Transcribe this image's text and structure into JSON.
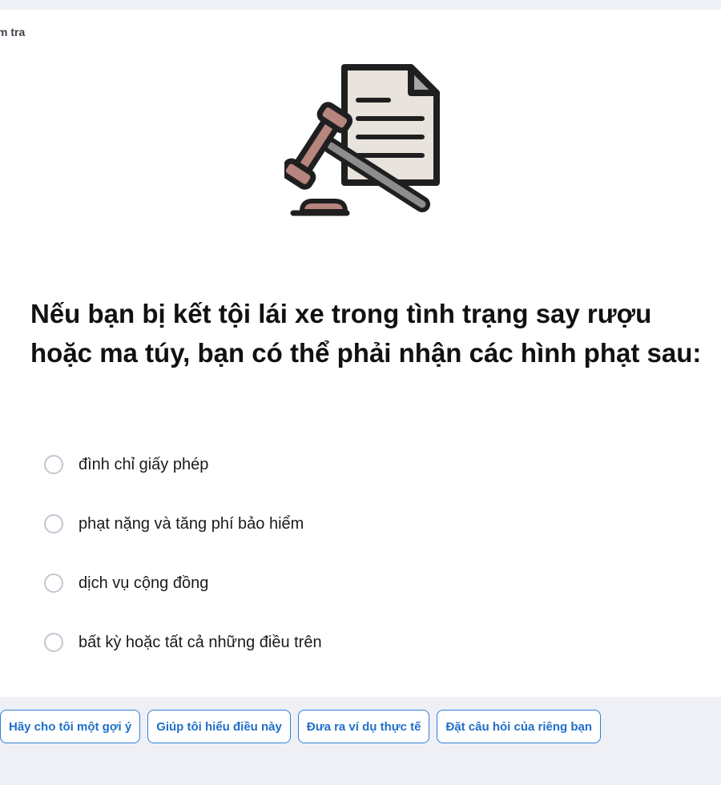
{
  "breadcrumb": "m tra",
  "illustration": {
    "icon": "gavel-document-icon",
    "colors": {
      "outline": "#1f1f1f",
      "paper": "#e8e3dc",
      "gavel_head": "#b5857e",
      "handle": "#8d8d8d"
    }
  },
  "question": "Nếu bạn bị kết tội lái xe trong tình trạng say rượu hoặc ma túy, bạn có thể phải nhận các hình phạt sau:",
  "options": [
    {
      "label": "đình chỉ giấy phép"
    },
    {
      "label": "phạt nặng và tăng phí bảo hiểm"
    },
    {
      "label": "dịch vụ cộng đồng"
    },
    {
      "label": "bất kỳ hoặc tất cả những điều trên"
    }
  ],
  "suggestions": [
    {
      "label": "Hãy cho tôi một gợi ý"
    },
    {
      "label": "Giúp tôi hiểu điều này"
    },
    {
      "label": "Đưa ra ví dụ thực tế"
    },
    {
      "label": "Đặt câu hỏi của riêng bạn"
    }
  ],
  "colors": {
    "page_bg": "#eef0f6",
    "card_bg": "#ffffff",
    "accent": "#1f6fc9",
    "radio_border": "#c4c6d0"
  }
}
